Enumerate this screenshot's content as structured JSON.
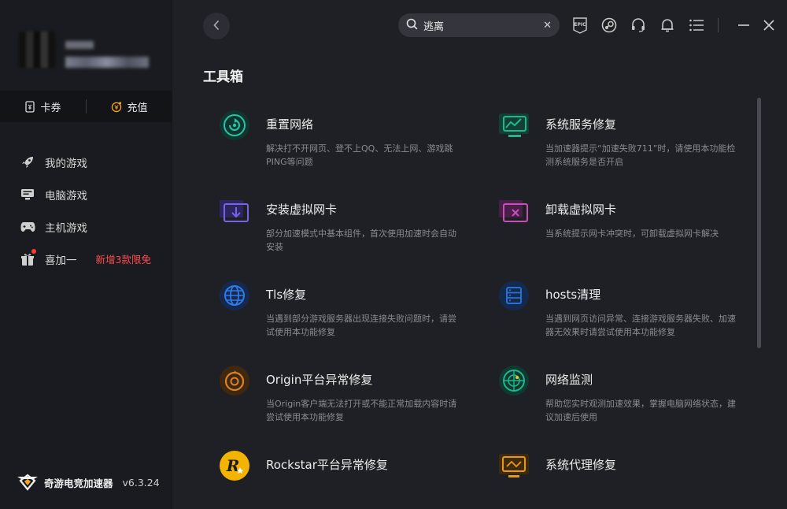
{
  "sidebar": {
    "wallet": {
      "coupon_label": "卡券",
      "recharge_label": "充值"
    },
    "nav": [
      {
        "label": "我的游戏",
        "icon": "rocket-icon"
      },
      {
        "label": "电脑游戏",
        "icon": "monitor-icon"
      },
      {
        "label": "主机游戏",
        "icon": "gamepad-icon"
      },
      {
        "label": "喜加一",
        "icon": "gift-icon",
        "badge": "新增3款限免"
      }
    ],
    "brand": {
      "name": "奇游电竞加速器",
      "version": "v6.3.24"
    }
  },
  "header": {
    "search": {
      "value": "逃离",
      "placeholder": ""
    },
    "icons": [
      "epic-icon",
      "steam-icon",
      "headset-icon",
      "bell-icon",
      "menu-list-icon"
    ]
  },
  "page": {
    "title": "工具箱",
    "tools": [
      {
        "name": "重置网络",
        "desc": "解决打不开网页、登不上QQ、无法上网、游戏跳PING等问题",
        "color": "#27c4a8"
      },
      {
        "name": "系统服务修复",
        "desc": "当加速器提示“加速失败711”时，请使用本功能检测系统服务是否开启",
        "color": "#1fb98a"
      },
      {
        "name": "安装虚拟网卡",
        "desc": "部分加速模式中基本组件，首次使用加速时会自动安装",
        "color": "#7a63e0"
      },
      {
        "name": "卸载虚拟网卡",
        "desc": "当系统提示网卡冲突时，可卸载虚拟网卡解决",
        "color": "#c64fb8"
      },
      {
        "name": "Tls修复",
        "desc": "当遇到部分游戏服务器出现连接失败问题时，请尝试使用本功能修复",
        "color": "#2f7be8"
      },
      {
        "name": "hosts清理",
        "desc": "当遇到网页访问异常、连接游戏服务器失败、加速器无效果时请尝试使用本功能修复",
        "color": "#2a6fd6"
      },
      {
        "name": "Origin平台异常修复",
        "desc": "当Origin客户端无法打开或不能正常加载内容时请尝试使用本功能修复",
        "color": "#d9822b"
      },
      {
        "name": "网络监测",
        "desc": "帮助您实时观测加速效果，掌握电脑网络状态，建议加速后使用",
        "color": "#22b58e"
      },
      {
        "name": "Rockstar平台异常修复",
        "desc": "",
        "color": "#f2b400"
      },
      {
        "name": "系统代理修复",
        "desc": "",
        "color": "#e59a1c"
      }
    ]
  }
}
